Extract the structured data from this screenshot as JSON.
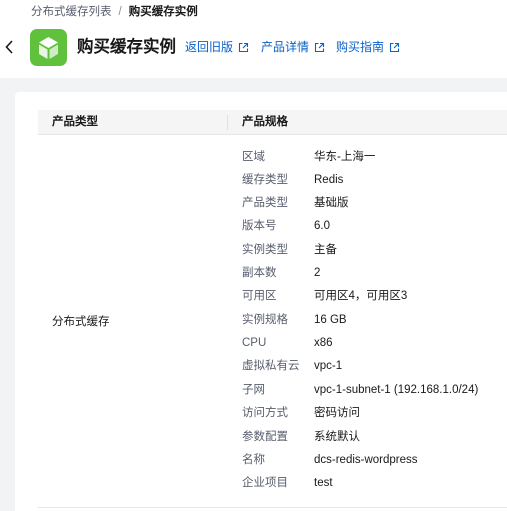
{
  "breadcrumb": {
    "parent": "分布式缓存列表",
    "separator": "/",
    "current": "购买缓存实例"
  },
  "header": {
    "title": "购买缓存实例",
    "logo_color": "#5fc13c",
    "links": [
      {
        "label": "返回旧版",
        "icon": "external-link-icon"
      },
      {
        "label": "产品详情",
        "icon": "external-link-icon"
      },
      {
        "label": "购买指南",
        "icon": "external-link-icon"
      }
    ]
  },
  "table": {
    "columns": [
      "产品类型",
      "产品规格"
    ],
    "product_type": "分布式缓存",
    "specs": [
      {
        "key": "区域",
        "value": "华东-上海一"
      },
      {
        "key": "缓存类型",
        "value": "Redis"
      },
      {
        "key": "产品类型",
        "value": "基础版"
      },
      {
        "key": "版本号",
        "value": "6.0"
      },
      {
        "key": "实例类型",
        "value": "主备"
      },
      {
        "key": "副本数",
        "value": "2"
      },
      {
        "key": "可用区",
        "value": "可用区4，可用区3"
      },
      {
        "key": "实例规格",
        "value": "16 GB"
      },
      {
        "key": "CPU",
        "value": "x86"
      },
      {
        "key": "虚拟私有云",
        "value": "vpc-1"
      },
      {
        "key": "子网",
        "value": "vpc-1-subnet-1 (192.168.1.0/24)"
      },
      {
        "key": "访问方式",
        "value": "密码访问"
      },
      {
        "key": "参数配置",
        "value": "系统默认"
      },
      {
        "key": "名称",
        "value": "dcs-redis-wordpress"
      },
      {
        "key": "企业项目",
        "value": "test"
      }
    ]
  }
}
